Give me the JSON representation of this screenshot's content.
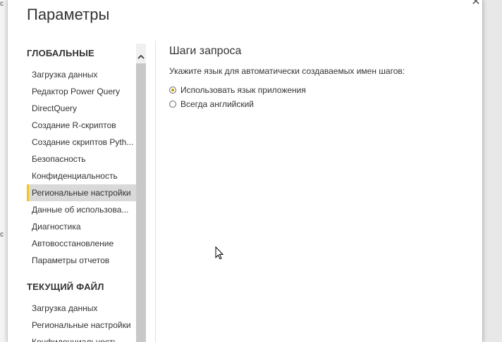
{
  "dialog": {
    "title": "Параметры",
    "close_glyph": "✕"
  },
  "sidebar": {
    "global_header": "ГЛОБАЛЬНЫЕ",
    "global_items": [
      {
        "label": "Загрузка данных"
      },
      {
        "label": "Редактор Power Query"
      },
      {
        "label": "DirectQuery"
      },
      {
        "label": "Создание R-скриптов"
      },
      {
        "label": "Создание скриптов Pyth..."
      },
      {
        "label": "Безопасность"
      },
      {
        "label": "Конфиденциальность"
      },
      {
        "label": "Региональные настройки",
        "selected": true
      },
      {
        "label": "Данные об использова..."
      },
      {
        "label": "Диагностика"
      },
      {
        "label": "Автовосстановление"
      },
      {
        "label": "Параметры отчетов"
      }
    ],
    "current_header": "ТЕКУЩИЙ ФАЙЛ",
    "current_items": [
      {
        "label": "Загрузка данных"
      },
      {
        "label": "Региональные настройки"
      },
      {
        "label": "Конфиденциальность"
      }
    ]
  },
  "content": {
    "title": "Шаги запроса",
    "description": "Укажите язык для автоматически создаваемых имен шагов:",
    "options": [
      {
        "label": "Использовать язык приложения",
        "checked": true
      },
      {
        "label": "Всегда английский",
        "checked": false
      }
    ]
  },
  "colors": {
    "accent": "#f2c811",
    "selected_bg": "#d9d9d9"
  },
  "background_fragments": [
    "c",
    "c"
  ]
}
